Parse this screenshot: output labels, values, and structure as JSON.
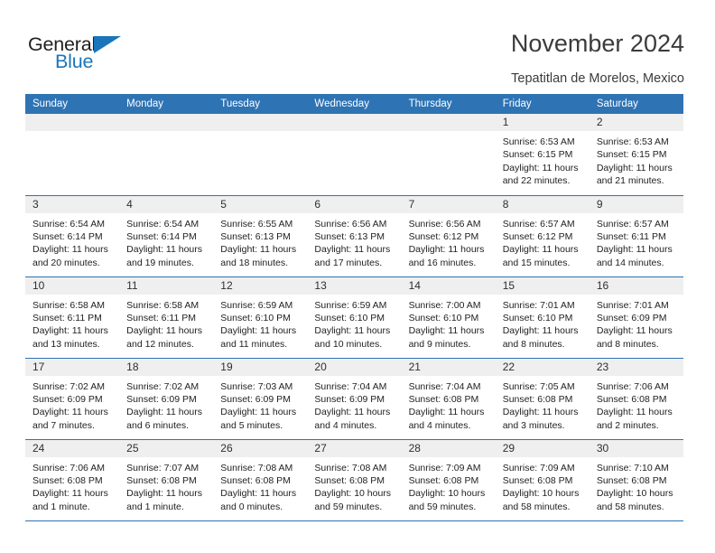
{
  "brand": {
    "name_part1": "General",
    "name_part2": "Blue",
    "accent_color": "#1b75bb"
  },
  "header": {
    "title": "November 2024",
    "subtitle": "Tepatitlan de Morelos, Mexico"
  },
  "calendar": {
    "header_color": "#2e73b4",
    "daynum_band_color": "#efefef",
    "weekdays": [
      "Sunday",
      "Monday",
      "Tuesday",
      "Wednesday",
      "Thursday",
      "Friday",
      "Saturday"
    ],
    "weeks": [
      [
        {
          "day": "",
          "empty": true
        },
        {
          "day": "",
          "empty": true
        },
        {
          "day": "",
          "empty": true
        },
        {
          "day": "",
          "empty": true
        },
        {
          "day": "",
          "empty": true
        },
        {
          "day": "1",
          "sunrise": "Sunrise: 6:53 AM",
          "sunset": "Sunset: 6:15 PM",
          "daylight": "Daylight: 11 hours and 22 minutes."
        },
        {
          "day": "2",
          "sunrise": "Sunrise: 6:53 AM",
          "sunset": "Sunset: 6:15 PM",
          "daylight": "Daylight: 11 hours and 21 minutes."
        }
      ],
      [
        {
          "day": "3",
          "sunrise": "Sunrise: 6:54 AM",
          "sunset": "Sunset: 6:14 PM",
          "daylight": "Daylight: 11 hours and 20 minutes."
        },
        {
          "day": "4",
          "sunrise": "Sunrise: 6:54 AM",
          "sunset": "Sunset: 6:14 PM",
          "daylight": "Daylight: 11 hours and 19 minutes."
        },
        {
          "day": "5",
          "sunrise": "Sunrise: 6:55 AM",
          "sunset": "Sunset: 6:13 PM",
          "daylight": "Daylight: 11 hours and 18 minutes."
        },
        {
          "day": "6",
          "sunrise": "Sunrise: 6:56 AM",
          "sunset": "Sunset: 6:13 PM",
          "daylight": "Daylight: 11 hours and 17 minutes."
        },
        {
          "day": "7",
          "sunrise": "Sunrise: 6:56 AM",
          "sunset": "Sunset: 6:12 PM",
          "daylight": "Daylight: 11 hours and 16 minutes."
        },
        {
          "day": "8",
          "sunrise": "Sunrise: 6:57 AM",
          "sunset": "Sunset: 6:12 PM",
          "daylight": "Daylight: 11 hours and 15 minutes."
        },
        {
          "day": "9",
          "sunrise": "Sunrise: 6:57 AM",
          "sunset": "Sunset: 6:11 PM",
          "daylight": "Daylight: 11 hours and 14 minutes."
        }
      ],
      [
        {
          "day": "10",
          "sunrise": "Sunrise: 6:58 AM",
          "sunset": "Sunset: 6:11 PM",
          "daylight": "Daylight: 11 hours and 13 minutes."
        },
        {
          "day": "11",
          "sunrise": "Sunrise: 6:58 AM",
          "sunset": "Sunset: 6:11 PM",
          "daylight": "Daylight: 11 hours and 12 minutes."
        },
        {
          "day": "12",
          "sunrise": "Sunrise: 6:59 AM",
          "sunset": "Sunset: 6:10 PM",
          "daylight": "Daylight: 11 hours and 11 minutes."
        },
        {
          "day": "13",
          "sunrise": "Sunrise: 6:59 AM",
          "sunset": "Sunset: 6:10 PM",
          "daylight": "Daylight: 11 hours and 10 minutes."
        },
        {
          "day": "14",
          "sunrise": "Sunrise: 7:00 AM",
          "sunset": "Sunset: 6:10 PM",
          "daylight": "Daylight: 11 hours and 9 minutes."
        },
        {
          "day": "15",
          "sunrise": "Sunrise: 7:01 AM",
          "sunset": "Sunset: 6:10 PM",
          "daylight": "Daylight: 11 hours and 8 minutes."
        },
        {
          "day": "16",
          "sunrise": "Sunrise: 7:01 AM",
          "sunset": "Sunset: 6:09 PM",
          "daylight": "Daylight: 11 hours and 8 minutes."
        }
      ],
      [
        {
          "day": "17",
          "sunrise": "Sunrise: 7:02 AM",
          "sunset": "Sunset: 6:09 PM",
          "daylight": "Daylight: 11 hours and 7 minutes."
        },
        {
          "day": "18",
          "sunrise": "Sunrise: 7:02 AM",
          "sunset": "Sunset: 6:09 PM",
          "daylight": "Daylight: 11 hours and 6 minutes."
        },
        {
          "day": "19",
          "sunrise": "Sunrise: 7:03 AM",
          "sunset": "Sunset: 6:09 PM",
          "daylight": "Daylight: 11 hours and 5 minutes."
        },
        {
          "day": "20",
          "sunrise": "Sunrise: 7:04 AM",
          "sunset": "Sunset: 6:09 PM",
          "daylight": "Daylight: 11 hours and 4 minutes."
        },
        {
          "day": "21",
          "sunrise": "Sunrise: 7:04 AM",
          "sunset": "Sunset: 6:08 PM",
          "daylight": "Daylight: 11 hours and 4 minutes."
        },
        {
          "day": "22",
          "sunrise": "Sunrise: 7:05 AM",
          "sunset": "Sunset: 6:08 PM",
          "daylight": "Daylight: 11 hours and 3 minutes."
        },
        {
          "day": "23",
          "sunrise": "Sunrise: 7:06 AM",
          "sunset": "Sunset: 6:08 PM",
          "daylight": "Daylight: 11 hours and 2 minutes."
        }
      ],
      [
        {
          "day": "24",
          "sunrise": "Sunrise: 7:06 AM",
          "sunset": "Sunset: 6:08 PM",
          "daylight": "Daylight: 11 hours and 1 minute."
        },
        {
          "day": "25",
          "sunrise": "Sunrise: 7:07 AM",
          "sunset": "Sunset: 6:08 PM",
          "daylight": "Daylight: 11 hours and 1 minute."
        },
        {
          "day": "26",
          "sunrise": "Sunrise: 7:08 AM",
          "sunset": "Sunset: 6:08 PM",
          "daylight": "Daylight: 11 hours and 0 minutes."
        },
        {
          "day": "27",
          "sunrise": "Sunrise: 7:08 AM",
          "sunset": "Sunset: 6:08 PM",
          "daylight": "Daylight: 10 hours and 59 minutes."
        },
        {
          "day": "28",
          "sunrise": "Sunrise: 7:09 AM",
          "sunset": "Sunset: 6:08 PM",
          "daylight": "Daylight: 10 hours and 59 minutes."
        },
        {
          "day": "29",
          "sunrise": "Sunrise: 7:09 AM",
          "sunset": "Sunset: 6:08 PM",
          "daylight": "Daylight: 10 hours and 58 minutes."
        },
        {
          "day": "30",
          "sunrise": "Sunrise: 7:10 AM",
          "sunset": "Sunset: 6:08 PM",
          "daylight": "Daylight: 10 hours and 58 minutes."
        }
      ]
    ]
  }
}
